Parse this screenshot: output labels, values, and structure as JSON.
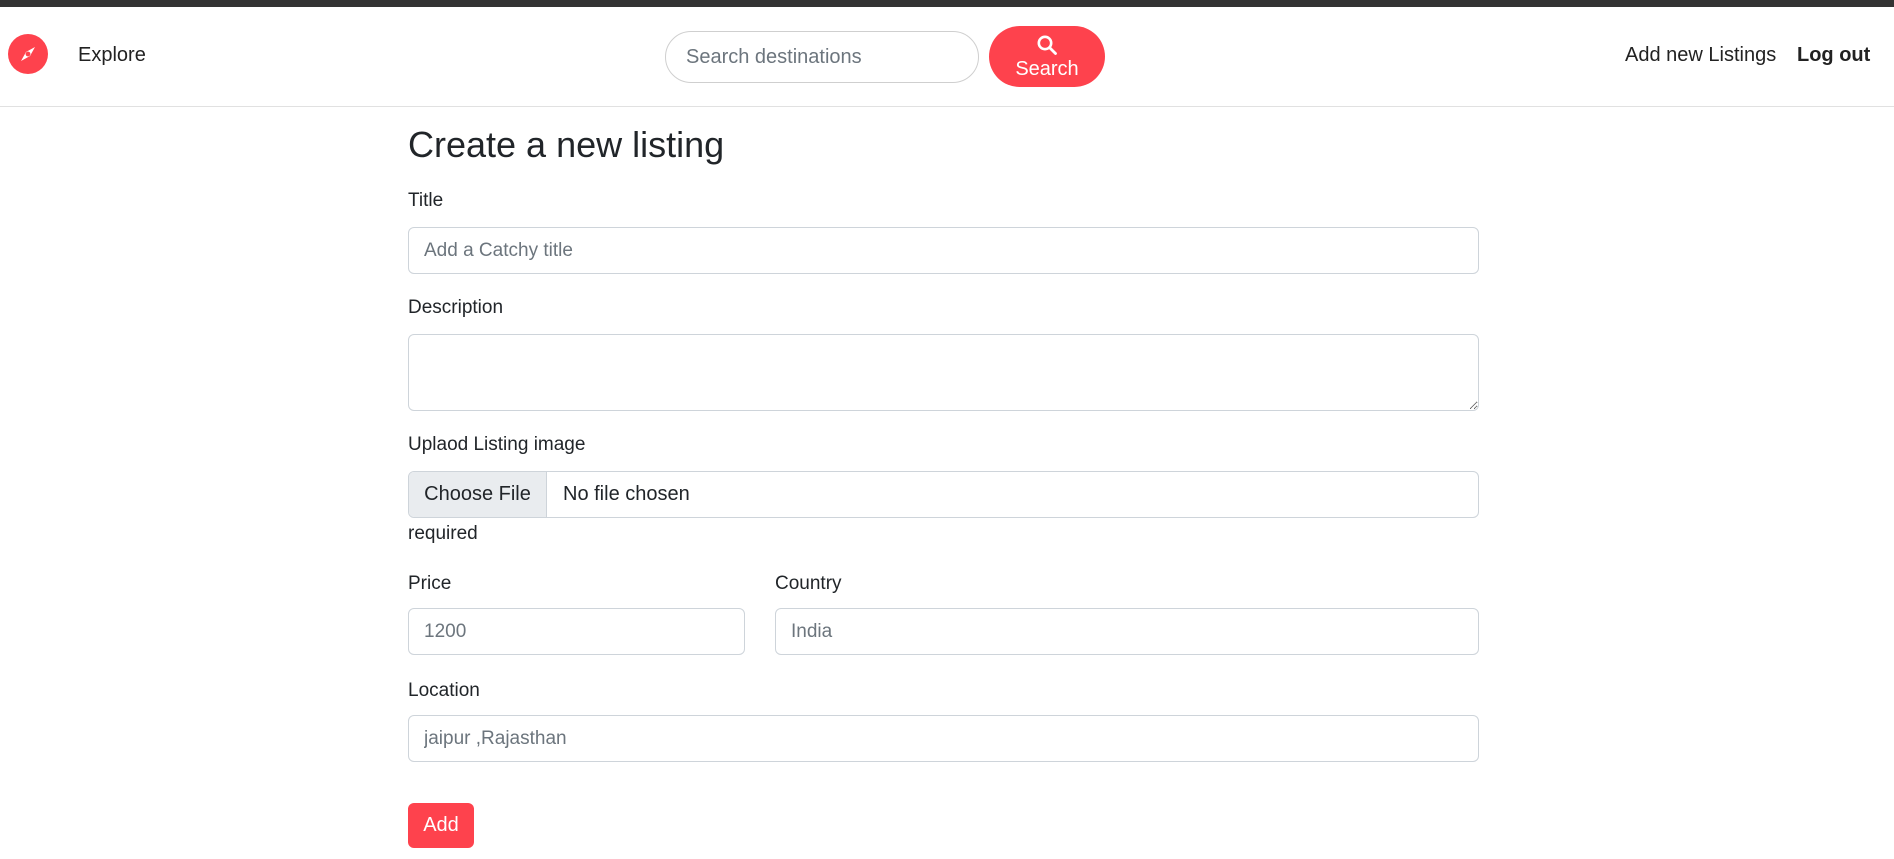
{
  "colors": {
    "accent": "#fe424d",
    "topbar": "#333333"
  },
  "navbar": {
    "logo_icon": "compass-icon",
    "explore_label": "Explore",
    "search": {
      "placeholder": "Search destinations",
      "value": "",
      "button_label": "Search",
      "button_icon": "search-icon"
    },
    "add_listing_label": "Add new Listings",
    "logout_label": "Log out"
  },
  "form": {
    "heading": "Create a new listing",
    "title": {
      "label": "Title",
      "placeholder": "Add a Catchy title",
      "value": ""
    },
    "description": {
      "label": "Description",
      "value": ""
    },
    "image": {
      "label": "Uplaod Listing image",
      "choose_label": "Choose File",
      "status": "No file chosen",
      "required_text": "required"
    },
    "price": {
      "label": "Price",
      "placeholder": "1200",
      "value": ""
    },
    "country": {
      "label": "Country",
      "placeholder": "India",
      "value": ""
    },
    "location": {
      "label": "Location",
      "placeholder": "jaipur ,Rajasthan",
      "value": ""
    },
    "submit_label": "Add"
  }
}
